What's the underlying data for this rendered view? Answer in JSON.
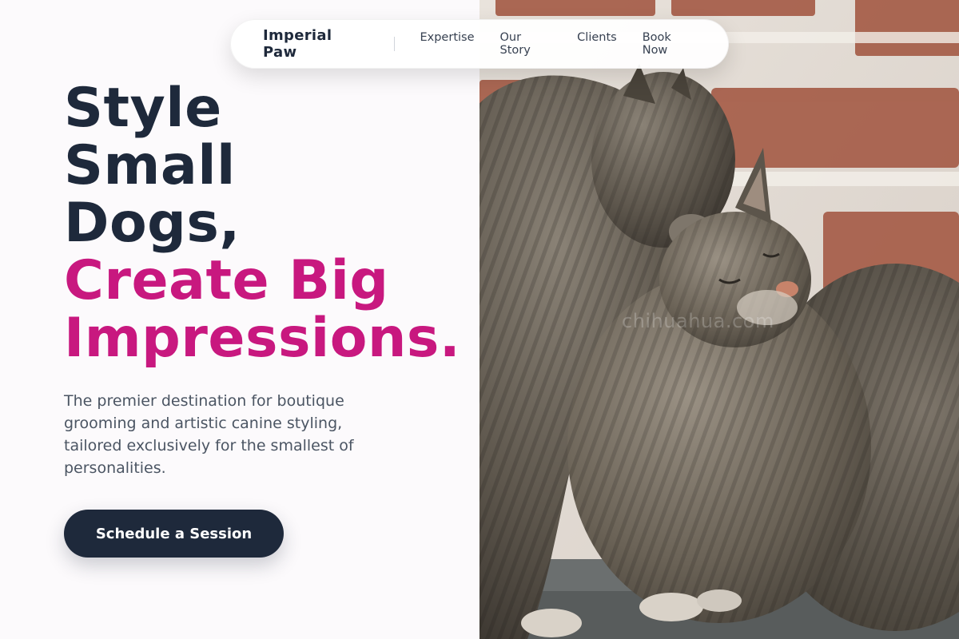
{
  "nav": {
    "brand": "Imperial Paw",
    "links": [
      "Expertise",
      "Our Story",
      "Clients",
      "Book Now"
    ]
  },
  "hero": {
    "headline_dark": [
      "Style",
      "Small",
      "Dogs,"
    ],
    "headline_accent": [
      "Create Big",
      "Impressions."
    ],
    "subtitle": "The premier destination for boutique grooming and artistic canine styling, tailored exclusively for the smallest of personalities.",
    "cta_label": "Schedule a Session"
  },
  "photo": {
    "watermark": "chihuahua.com",
    "subject": "two tabby cats nuzzling against a brick wall"
  },
  "colors": {
    "dark": "#1e293b",
    "accent": "#c8187f",
    "subtitle": "#4b5563",
    "background": "#fcfafc"
  }
}
